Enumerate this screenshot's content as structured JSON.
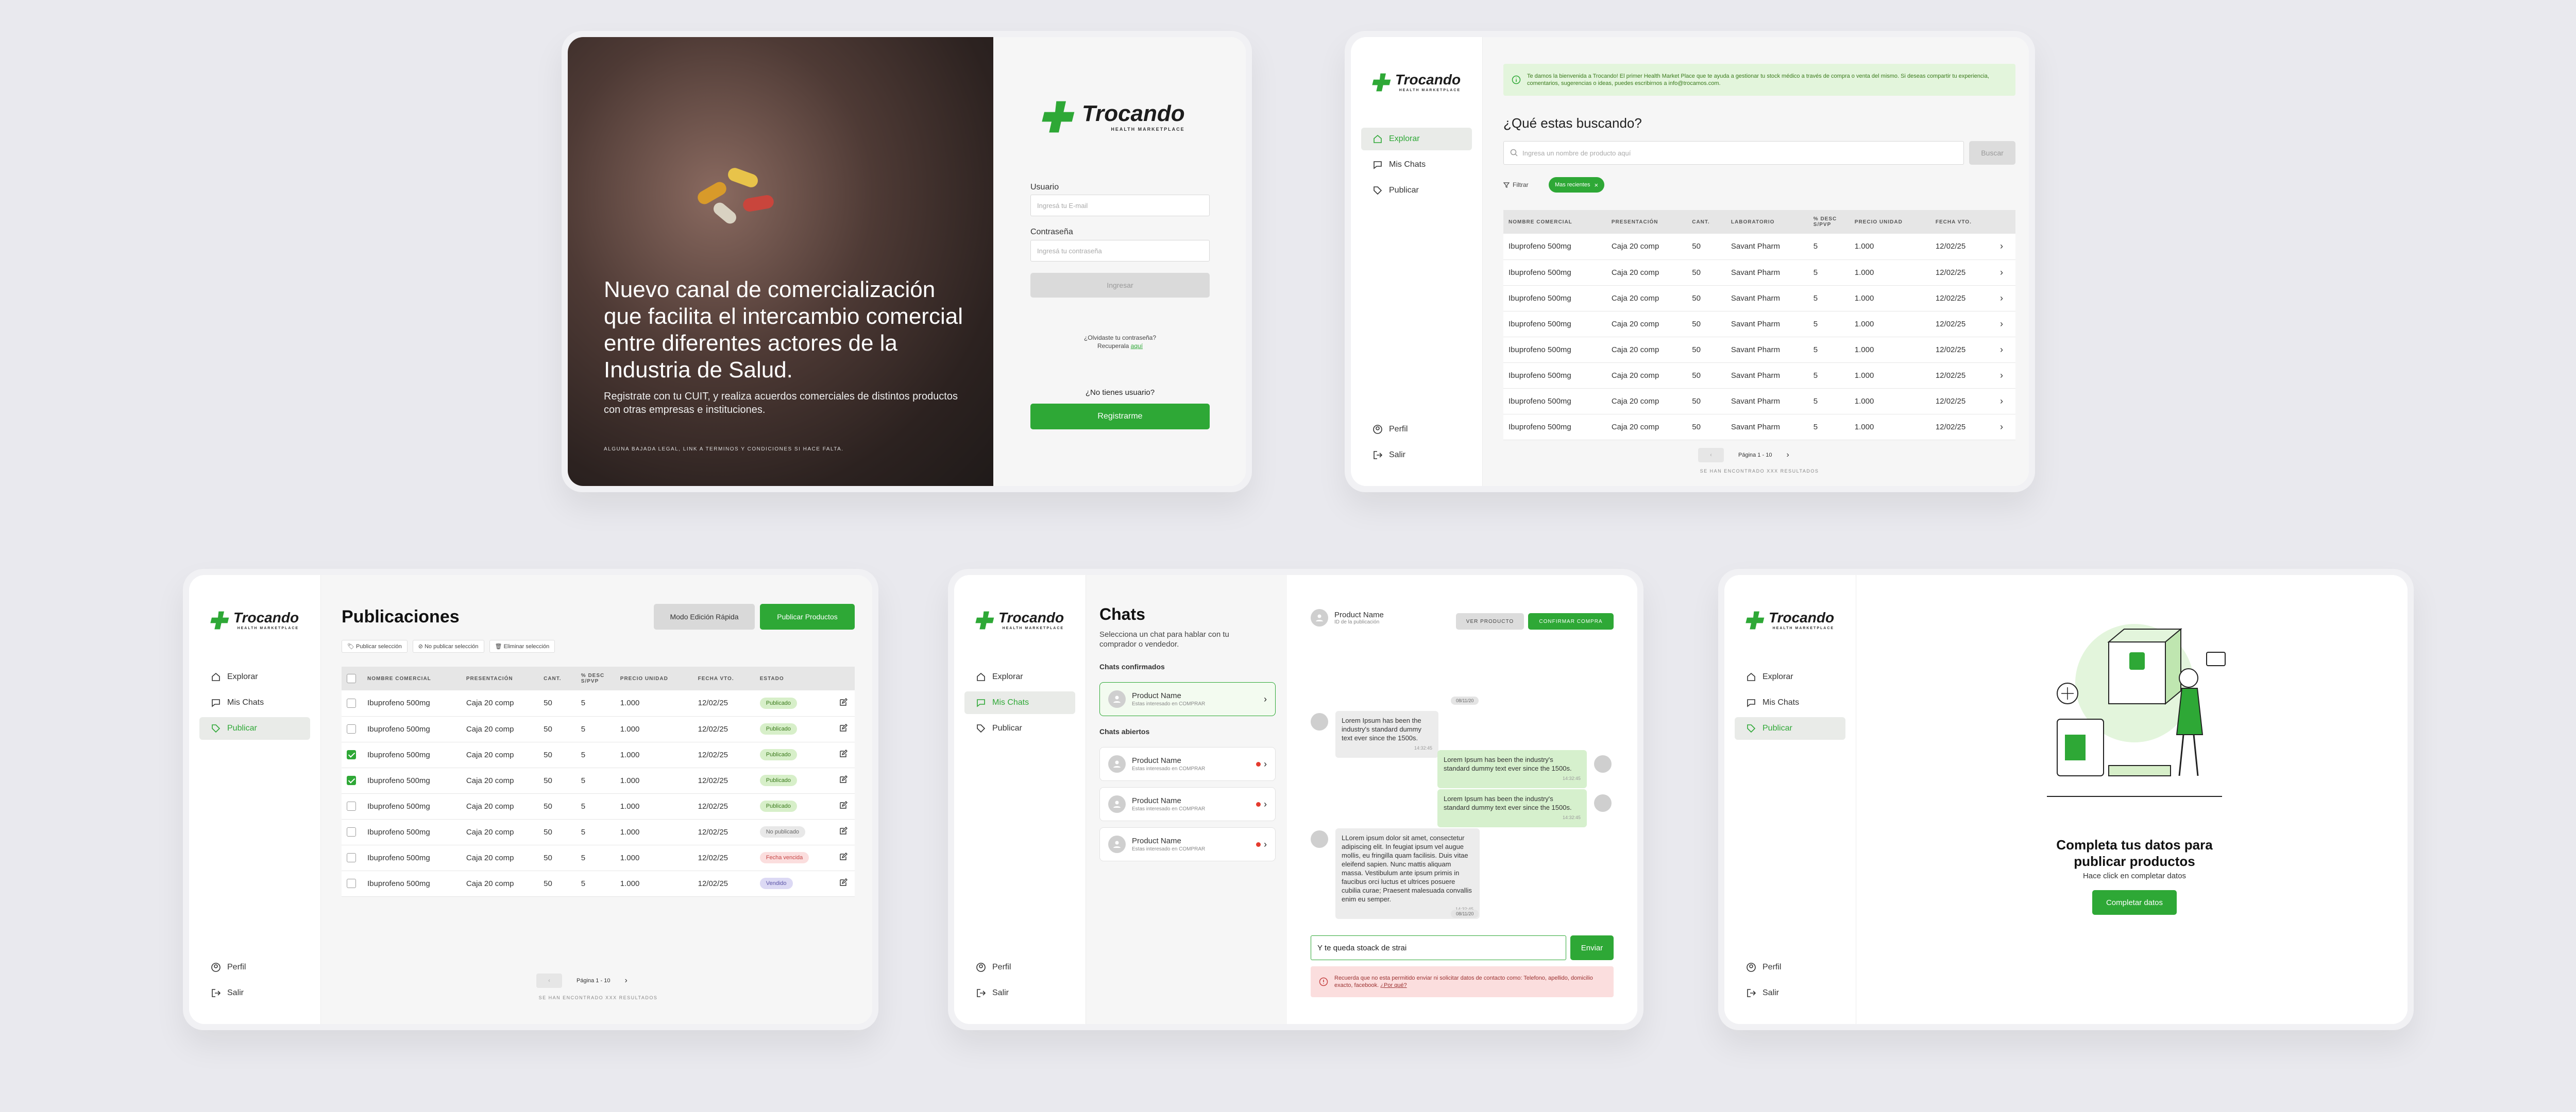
{
  "brand": {
    "name": "Trocando",
    "tagline": "HEALTH MARKETPLACE"
  },
  "nav": {
    "explore": "Explorar",
    "chats": "Mis Chats",
    "publish": "Publicar",
    "profile": "Perfil",
    "logout": "Salir"
  },
  "login": {
    "hero_title": "Nuevo canal de comercialización que facilita el intercambio comercial entre diferentes actores de la Industria de Salud.",
    "hero_sub": "Registrate con tu CUIT, y realiza acuerdos comerciales de distintos productos con otras empresas e instituciones.",
    "legal": "ALGUNA BAJADA LEGAL, LINK A TERMINOS Y CONDICIONES SI HACE FALTA.",
    "user_label": "Usuario",
    "user_placeholder": "Ingresá tu E-mail",
    "pass_label": "Contraseña",
    "pass_placeholder": "Ingresá tu contraseña",
    "login_button": "Ingresar",
    "forgot": "¿Olvidaste tu contraseña?",
    "recover_prefix": "Recuperala",
    "recover_link": "aquí",
    "no_account": "¿No tienes usuario?",
    "register_button": "Registrarme"
  },
  "explore": {
    "banner": "Te damos la bienvenida a Trocando! El primer Health Market Place que te ayuda a gestionar tu stock médico a través de compra o venta del mismo. Si deseas compartir tu experiencia, comentarios, sugerencias o ideas, puedes escribirnos a info@trocamos.com.",
    "question": "¿Qué estas buscando?",
    "search_placeholder": "Ingresa un nombre de producto aquí",
    "search_button": "Buscar",
    "filter": "Filtrar",
    "chip": "Mas recientes",
    "columns": [
      "NOMBRE COMERCIAL",
      "PRESENTACIÓN",
      "CANT.",
      "LABORATORIO",
      "% DESC S/PVP",
      "PRECIO UNIDAD",
      "FECHA VTO."
    ],
    "rows": [
      [
        "Ibuprofeno 500mg",
        "Caja 20 comp",
        "50",
        "Savant Pharm",
        "5",
        "1.000",
        "12/02/25"
      ],
      [
        "Ibuprofeno 500mg",
        "Caja 20 comp",
        "50",
        "Savant Pharm",
        "5",
        "1.000",
        "12/02/25"
      ],
      [
        "Ibuprofeno 500mg",
        "Caja 20 comp",
        "50",
        "Savant Pharm",
        "5",
        "1.000",
        "12/02/25"
      ],
      [
        "Ibuprofeno 500mg",
        "Caja 20 comp",
        "50",
        "Savant Pharm",
        "5",
        "1.000",
        "12/02/25"
      ],
      [
        "Ibuprofeno 500mg",
        "Caja 20 comp",
        "50",
        "Savant Pharm",
        "5",
        "1.000",
        "12/02/25"
      ],
      [
        "Ibuprofeno 500mg",
        "Caja 20 comp",
        "50",
        "Savant Pharm",
        "5",
        "1.000",
        "12/02/25"
      ],
      [
        "Ibuprofeno 500mg",
        "Caja 20 comp",
        "50",
        "Savant Pharm",
        "5",
        "1.000",
        "12/02/25"
      ],
      [
        "Ibuprofeno 500mg",
        "Caja 20 comp",
        "50",
        "Savant Pharm",
        "5",
        "1.000",
        "12/02/25"
      ]
    ],
    "page": "Página 1 - 10",
    "results": "SE HAN ENCONTRADO XXX RESULTADOS"
  },
  "pubs": {
    "title": "Publicaciones",
    "quick_edit": "Modo Edición Rápida",
    "publish_products": "Publicar Productos",
    "bulk": [
      "Publicar selección",
      "No publicar selección",
      "Eliminar selección"
    ],
    "columns": [
      "NOMBRE COMERCIAL",
      "PRESENTACIÓN",
      "CANT.",
      "% DESC S/PVP",
      "PRECIO UNIDAD",
      "FECHA VTO.",
      "ESTADO"
    ],
    "rows": [
      {
        "c": [
          "Ibuprofeno 500mg",
          "Caja 20 comp",
          "50",
          "5",
          "1.000",
          "12/02/25"
        ],
        "status": "Publicado",
        "checked": false
      },
      {
        "c": [
          "Ibuprofeno 500mg",
          "Caja 20 comp",
          "50",
          "5",
          "1.000",
          "12/02/25"
        ],
        "status": "Publicado",
        "checked": false
      },
      {
        "c": [
          "Ibuprofeno 500mg",
          "Caja 20 comp",
          "50",
          "5",
          "1.000",
          "12/02/25"
        ],
        "status": "Publicado",
        "checked": true
      },
      {
        "c": [
          "Ibuprofeno 500mg",
          "Caja 20 comp",
          "50",
          "5",
          "1.000",
          "12/02/25"
        ],
        "status": "Publicado",
        "checked": true
      },
      {
        "c": [
          "Ibuprofeno 500mg",
          "Caja 20 comp",
          "50",
          "5",
          "1.000",
          "12/02/25"
        ],
        "status": "Publicado",
        "checked": false
      },
      {
        "c": [
          "Ibuprofeno 500mg",
          "Caja 20 comp",
          "50",
          "5",
          "1.000",
          "12/02/25"
        ],
        "status": "No publicado",
        "checked": false
      },
      {
        "c": [
          "Ibuprofeno 500mg",
          "Caja 20 comp",
          "50",
          "5",
          "1.000",
          "12/02/25"
        ],
        "status": "Fecha vencida",
        "checked": false
      },
      {
        "c": [
          "Ibuprofeno 500mg",
          "Caja 20 comp",
          "50",
          "5",
          "1.000",
          "12/02/25"
        ],
        "status": "Vendido",
        "checked": false
      }
    ],
    "page": "Página 1 - 10",
    "results": "SE HAN ENCONTRADO XXX RESULTADOS"
  },
  "chats": {
    "title": "Chats",
    "subtitle": "Selecciona un chat para hablar con tu comprador o vendedor.",
    "confirmed": "Chats confirmados",
    "open": "Chats abiertos",
    "item_name": "Product Name",
    "item_sub": "Estas interesado en COMPRAR",
    "header_name": "Product Name",
    "header_sub": "ID de la publicación",
    "view_product": "VER PRODUCTO",
    "confirm_purchase": "CONFIRMAR COMPRA",
    "date": "08/11/20",
    "m1": "Lorem Ipsum has been the industry's standard dummy text ever since the 1500s.",
    "m2": "Lorem Ipsum has been the industry's standard dummy text ever since the 1500s.",
    "m3": "Lorem Ipsum has been the industry's standard dummy text ever since the 1500s.",
    "m4": "LLorem ipsum dolor sit amet, consectetur adipiscing elit. In feugiat ipsum vel augue mollis, eu fringilla quam facilisis. Duis vitae eleifend sapien. Nunc mattis aliquam massa. Vestibulum ante ipsum primis in faucibus orci luctus et ultrices posuere cubilia curae; Praesent malesuada convallis enim eu semper.",
    "time": "14:32:45",
    "input": "Y te queda stoack de strai",
    "send": "Enviar",
    "warning": "Recuerda que no esta permitido enviar ni solicitar datos de contacto como: Telefono, apellido, domicilio exacto, facebook.",
    "warning_link": "¿Por qué?"
  },
  "complete": {
    "title": "Completa tus datos para publicar productos",
    "sub": "Hace click en completar datos",
    "button": "Completar datos"
  },
  "colors": {
    "green": "#2ea836",
    "badge_published": "#d7efc9",
    "badge_expired": "#fbdede",
    "badge_sold": "#dcd9f4"
  }
}
